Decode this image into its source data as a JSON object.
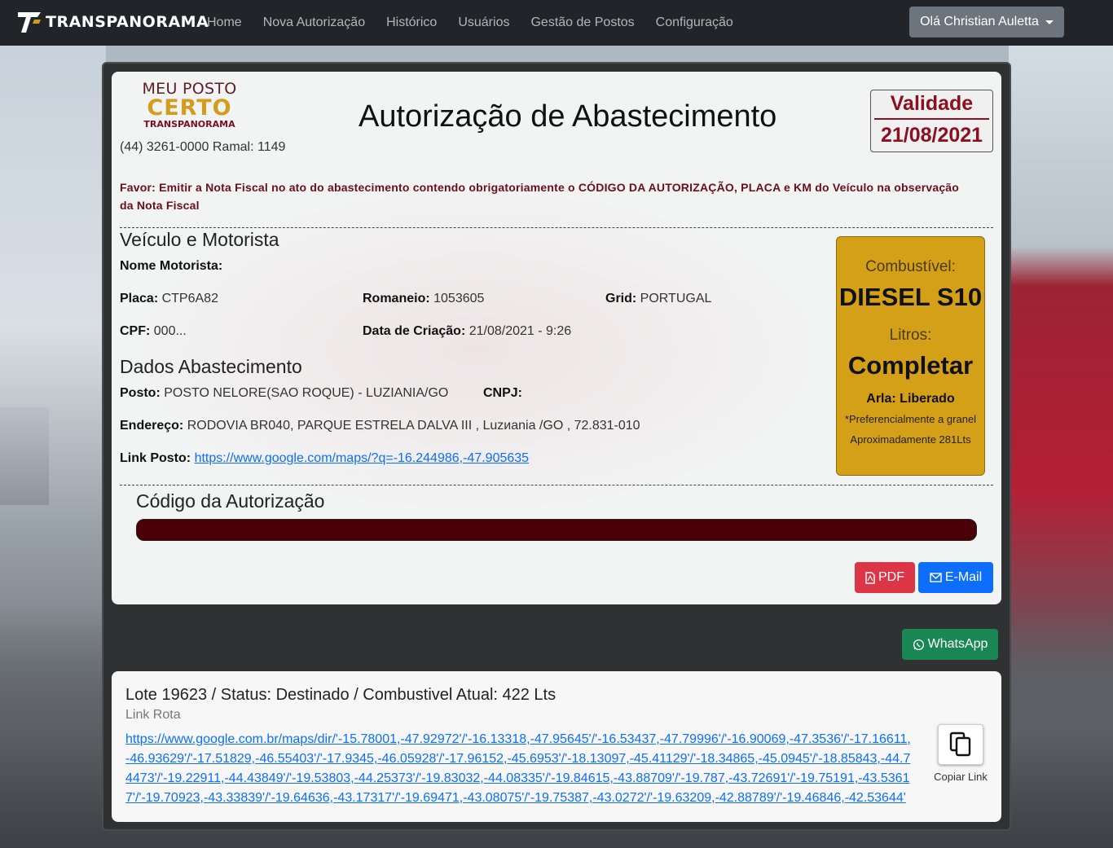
{
  "navbar": {
    "brand": "TRANSPANORAMA",
    "links": [
      "Home",
      "Nova Autorização",
      "Histórico",
      "Usuários",
      "Gestão de Postos",
      "Configuração"
    ],
    "user_greeting": "Olá Christian Auletta"
  },
  "header": {
    "logo_line1": "MEU POSTO",
    "logo_line2": "CERTO",
    "logo_line3": "TRANSPANORAMA",
    "phone": "(44) 3261-0000 Ramal: 1149",
    "title": "Autorização de Abastecimento",
    "validade_label": "Validade",
    "validade_date": "21/08/2021"
  },
  "notice": "Favor: Emitir a Nota Fiscal no ato do abastecimento contendo obrigatoriamente o CÓDIGO DA AUTORIZAÇÃO, PLACA e KM do Veículo na observação da Nota Fiscal",
  "vehicle": {
    "section_title": "Veículo e Motorista",
    "driver_label": "Nome Motorista:",
    "driver_value": "",
    "plate_label": "Placa:",
    "plate_value": "CTP6A82",
    "romaneio_label": "Romaneio:",
    "romaneio_value": "1053605",
    "grid_label": "Grid:",
    "grid_value": "PORTUGAL",
    "cpf_label": "CPF:",
    "cpf_value": "000...",
    "created_label": "Data de Criação:",
    "created_value": "21/08/2021 - 9:26"
  },
  "supply": {
    "section_title": "Dados Abastecimento",
    "posto_label": "Posto:",
    "posto_value": "POSTO NELORE(SAO ROQUE) - LUZIANIA/GO",
    "cnpj_label": "CNPJ:",
    "cnpj_value": "",
    "address_label": "Endereço:",
    "address_value": "RODOVIA BR040, PARQUE ESTRELA DALVA III , Luzиania /GO , 72.831-010",
    "link_label": "Link Posto:",
    "link_value": "https://www.google.com/maps/?q=-16.244986,-47.905635"
  },
  "fuel": {
    "fuel_label": "Combustível:",
    "fuel_value": "DIESEL S10",
    "liters_label": "Litros:",
    "liters_value": "Completar",
    "arla": "Arla: Liberado",
    "note": "*Preferencialmente a granel",
    "approx": "Aproximadamente 281Lts",
    "color": "#d4a017"
  },
  "authorization": {
    "section_title": "Código da Autorização",
    "bar_color": "#4a0006"
  },
  "actions": {
    "pdf_label": "PDF",
    "email_label": "E-Mail",
    "whatsapp_label": "WhatsApp"
  },
  "lote": {
    "summary": "Lote 19623 / Status: Destinado / Combustivel Atual: 422 Lts",
    "link_rota_label": "Link Rota",
    "route_url": "https://www.google.com.br/maps/dir/'-15.78001,-47.92972'/'-16.13318,-47.95645'/'-16.53437,-47.79996'/'-16.90069,-47.3536'/'-17.16611,-46.93629'/'-17.51829,-46.55403'/'-17.9345,-46.05928'/'-17.96152,-45.6953'/'-18.13097,-45.41129'/'-18.34865,-45.0945'/'-18.85843,-44.74473'/'-19.22911,-44.43849'/'-19.53803,-44.25373'/'-19.83032,-44.08335'/'-19.84615,-43.88709'/'-19.787,-43.72691'/'-19.75191,-43.53617'/'-19.70923,-43.33839'/'-19.64636,-43.17317'/'-19.69471,-43.08075'/'-19.75387,-43.0272'/'-19.63209,-42.88789'/'-19.46846,-42.53644'",
    "copy_label": "Copiar Link"
  },
  "icons": {
    "pdf": "file-pdf-icon",
    "email": "envelope-icon",
    "whatsapp": "whatsapp-icon",
    "copy": "copy-icon"
  }
}
